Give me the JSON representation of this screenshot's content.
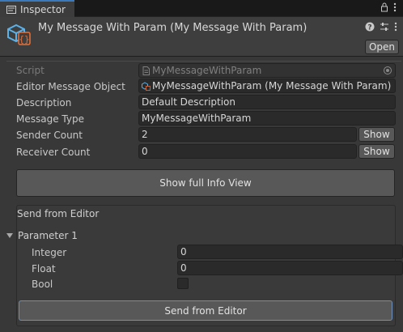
{
  "tab": {
    "label": "Inspector"
  },
  "header": {
    "title": "My Message With Param (My Message With Param)",
    "open_label": "Open"
  },
  "fields": {
    "script": {
      "label": "Script",
      "value": "MyMessageWithParam"
    },
    "editor_message_object": {
      "label": "Editor Message Object",
      "value": "MyMessageWithParam (My Message With Param)"
    },
    "description": {
      "label": "Description",
      "value": "Default Description"
    },
    "message_type": {
      "label": "Message Type",
      "value": "MyMessageWithParam"
    },
    "sender_count": {
      "label": "Sender Count",
      "value": "2",
      "button": "Show"
    },
    "receiver_count": {
      "label": "Receiver Count",
      "value": "0",
      "button": "Show"
    }
  },
  "info_button": "Show full Info View",
  "send_section": {
    "title": "Send from Editor",
    "parameter_label": "Parameter 1",
    "integer": {
      "label": "Integer",
      "value": "0"
    },
    "float": {
      "label": "Float",
      "value": "0"
    },
    "bool": {
      "label": "Bool",
      "checked": false
    },
    "send_button": "Send from Editor"
  },
  "icons": {
    "tab": "inspector-icon",
    "lock": "lock-icon",
    "more": "kebab-menu-icon",
    "object": "scriptable-object-icon",
    "help": "help-icon",
    "settings": "preset-settings-icon",
    "object_picker": "object-picker-icon"
  },
  "colors": {
    "accent": "#3a79bb",
    "background": "#383838",
    "field": "#2a2a2a",
    "button": "#585858"
  }
}
